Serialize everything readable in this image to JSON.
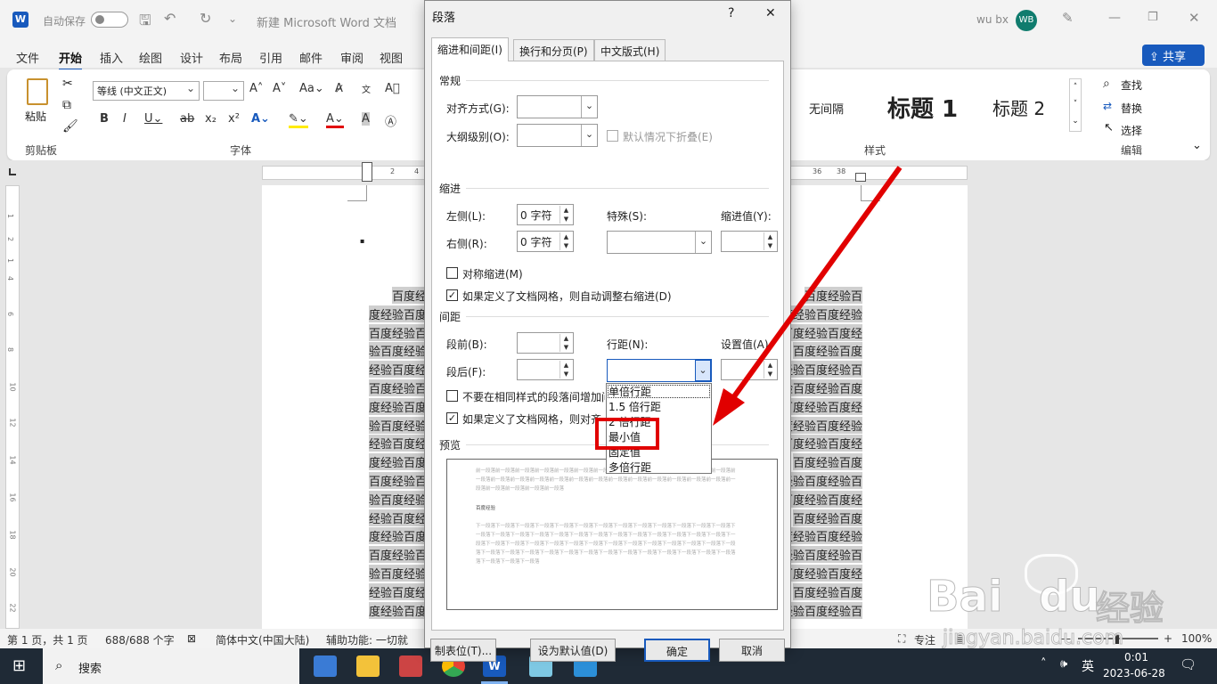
{
  "titlebar": {
    "autosave": "自动保存",
    "title": "新建 Microsoft Word 文档",
    "user": "wu bx",
    "initials": "WB",
    "share": "共享"
  },
  "tabs": [
    "文件",
    "开始",
    "插入",
    "绘图",
    "设计",
    "布局",
    "引用",
    "邮件",
    "审阅",
    "视图"
  ],
  "ribbon": {
    "paste": "粘贴",
    "clipboard": "剪贴板",
    "font_name": "等线 (中文正文)",
    "font_group": "字体",
    "styles_group": "样式",
    "editing_group": "编辑",
    "style_nospace": "无间隔",
    "style_h1": "标题 1",
    "style_h2": "标题 2",
    "find": "查找",
    "replace": "替换",
    "select": "选择"
  },
  "ruler": {
    "left_ticks": [
      "2",
      "4"
    ],
    "right_ticks": [
      "36",
      "38"
    ],
    "vticks": [
      "1",
      "2",
      "1",
      "4",
      "6",
      "8",
      "10",
      "12",
      "14",
      "16",
      "18",
      "20",
      "22"
    ]
  },
  "document": {
    "bullet": "▪",
    "left_lines": [
      "百度经",
      "度经验百度",
      "百度经验百",
      "验百度经验",
      "经验百度经",
      "百度经验百",
      "度经验百度",
      "验百度经验",
      "经验百度经",
      "度经验百度",
      "百度经验百",
      "验百度经验",
      "经验百度经",
      "度经验百度",
      "百度经验百",
      "验百度经验",
      "经验百度经",
      "度经验百度"
    ],
    "right_lines": [
      "百度经验百",
      "百度经验百度经验",
      "验百度经验百度经",
      "百度经验百度",
      "度经验百度经验百",
      "经验百度经验百度",
      "验百度经验百度经",
      "百度经验百度经验",
      "验百度经验百度经",
      "百度经验百度",
      "度经验百度经验百",
      "验百度经验百度经",
      "百度经验百度",
      "百度经验百度经验",
      "度经验百度经验百",
      "验百度经验百度经",
      "百度经验百度",
      "度经验百度经验百"
    ]
  },
  "status": {
    "page": "第 1 页，共 1 页",
    "words": "688/688 个字",
    "lang": "简体中文(中国大陆)",
    "access": "辅助功能: 一切就",
    "focus": "专注",
    "zoom": "100%"
  },
  "taskbar": {
    "search": "搜索",
    "ime": "英",
    "time": "0:01",
    "date": "2023-06-28"
  },
  "dialog": {
    "title": "段落",
    "help": "?",
    "close": "✕",
    "tabs": [
      "缩进和间距(I)",
      "换行和分页(P)",
      "中文版式(H)"
    ],
    "general": "常规",
    "align": "对齐方式(G):",
    "outline": "大纲级别(O):",
    "collapse": "默认情况下折叠(E)",
    "indent": "缩进",
    "left": "左侧(L):",
    "right": "右侧(R):",
    "left_val": "0 字符",
    "right_val": "0 字符",
    "special": "特殊(S):",
    "indent_by": "缩进值(Y):",
    "mirror": "对称缩进(M)",
    "auto_adjust": "如果定义了文档网格，则自动调整右缩进(D)",
    "spacing": "间距",
    "before": "段前(B):",
    "after": "段后(F):",
    "line_spacing": "行距(N):",
    "at": "设置值(A)",
    "no_space": "不要在相同样式的段落间增加间",
    "snap_grid": "如果定义了文档网格，则对齐",
    "preview": "预览",
    "preview_sample": "百度经验",
    "pv_prev": [
      "前一段落前一段落前一段落前一段落前一段落前一段落前一段落前一段落前一段落前一段落前一段落前一段落前一段落前",
      "一段落前一段落前一段落前一段落前一段落前一段落前一段落前一段落前一段落前一段落前一段落前一段落前一段落前一",
      "段落前一段落前一段落前一段落前一段落"
    ],
    "pv_next": [
      "下一段落下一段落下一段落下一段落下一段落下一段落下一段落下一段落下一段落下一段落下一段落下一段落下一段落下",
      "一段落下一段落下一段落下一段落下一段落下一段落下一段落下一段落下一段落下一段落下一段落下一段落下一段落下一",
      "段落下一段落下一段落下一段落下一段落下一段落下一段落下一段落下一段落下一段落下一段落下一段落下一段落下一段",
      "落下一段落下一段落下一段落下一段落下一段落下一段落下一段落下一段落下一段落下一段落下一段落下一段落下一段落",
      "落下一段落下一段落下一段落"
    ],
    "line_options": [
      "单倍行距",
      "1.5 倍行距",
      "2 倍行距",
      "最小值",
      "固定值",
      "多倍行距"
    ],
    "buttons": [
      "制表位(T)...",
      "设为默认值(D)",
      "确定",
      "取消"
    ]
  },
  "watermark": {
    "brand": "Bai",
    "brand2": "du",
    "cn": "经验",
    "url": "jingyan.baidu.com"
  },
  "colors": {
    "accent": "#185abd",
    "highlight": "#e10000"
  }
}
